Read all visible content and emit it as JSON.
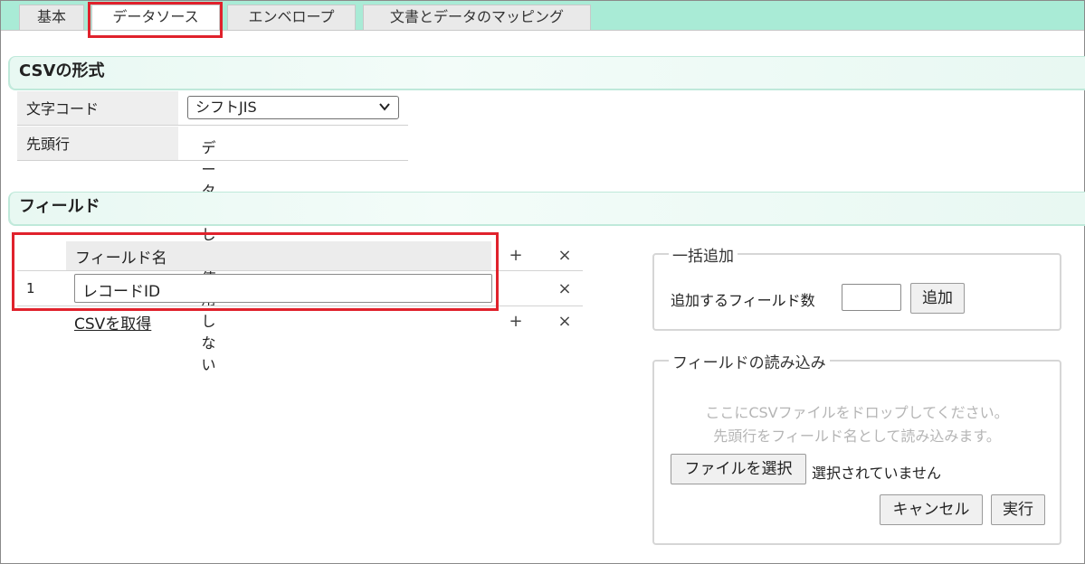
{
  "tabs": {
    "basic": "基本",
    "datasource": "データソース",
    "envelope": "エンベロープ",
    "mapping": "文書とデータのマッピング"
  },
  "csv_section": {
    "title": "CSVの形式",
    "encoding_label": "文字コード",
    "encoding_value": "シフトJIS",
    "header_label": "先頭行",
    "header_checkbox_label": "データとして使用しない"
  },
  "fields_section": {
    "title": "フィールド",
    "column_header": "フィールド名",
    "rows": [
      {
        "index": "1",
        "value": "レコードID"
      }
    ],
    "add_symbol": "+",
    "remove_symbol": "×",
    "get_csv_link": "CSVを取得"
  },
  "bulk_add": {
    "legend": "一括追加",
    "label": "追加するフィールド数",
    "button": "追加"
  },
  "import": {
    "legend": "フィールドの読み込み",
    "hint_line1": "ここにCSVファイルをドロップしてください。",
    "hint_line2": "先頭行をフィールド名として読み込みます。",
    "choose_button": "ファイルを選択",
    "no_file": "選択されていません",
    "cancel_button": "キャンセル",
    "run_button": "実行"
  },
  "colors": {
    "tabbar": "#a9ebd6",
    "highlight": "#e0222c"
  }
}
